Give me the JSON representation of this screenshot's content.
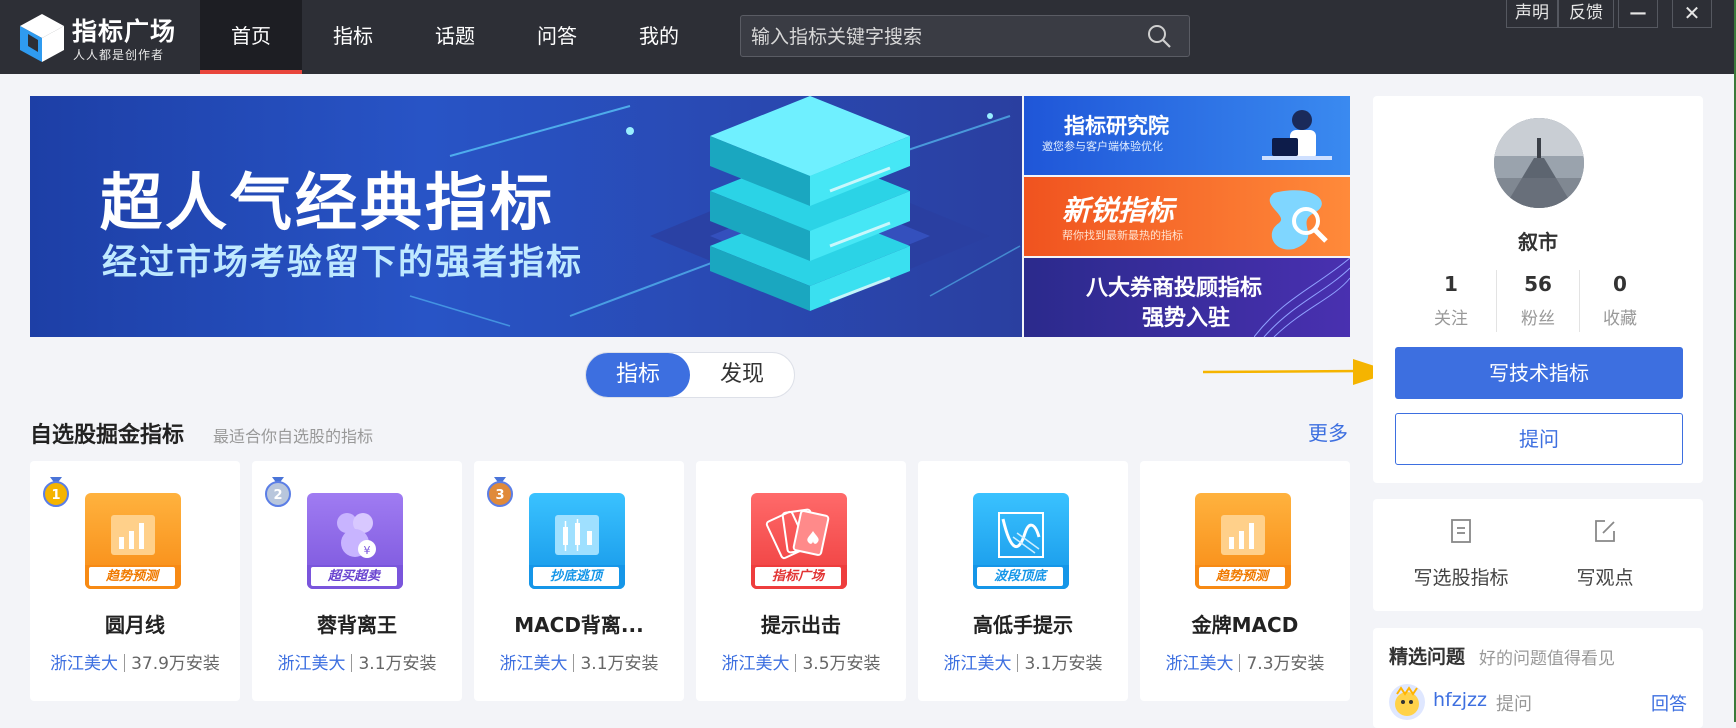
{
  "header": {
    "logo_title": "指标广场",
    "logo_subtitle": "人人都是创作者",
    "nav": [
      {
        "label": "首页",
        "active": true
      },
      {
        "label": "指标"
      },
      {
        "label": "话题"
      },
      {
        "label": "问答"
      },
      {
        "label": "我的"
      }
    ],
    "search_placeholder": "输入指标关键字搜索",
    "window_buttons": {
      "statement": "声明",
      "feedback": "反馈",
      "minimize": "—",
      "close": "✕"
    }
  },
  "banner": {
    "title": "超人气经典指标",
    "subtitle": "经过市场考验留下的强者指标",
    "side": [
      {
        "title": "指标研究院",
        "subtitle": "邀您参与客户端体验优化"
      },
      {
        "title": "新锐指标",
        "subtitle": "帮你找到最新最热的指标"
      },
      {
        "title_line1": "八大券商投顾指标",
        "title_line2": "强势入驻"
      }
    ]
  },
  "toggle": {
    "active": "指标",
    "inactive": "发现"
  },
  "section": {
    "title": "自选股掘金指标",
    "desc": "最适合你自选股的指标",
    "more": "更多"
  },
  "cards": [
    {
      "name": "圆月线",
      "author": "浙江美大",
      "installs": "37.9万安装",
      "tag": "趋势预测",
      "rank": "1"
    },
    {
      "name": "蓉背离王",
      "author": "浙江美大",
      "installs": "3.1万安装",
      "tag": "超买超卖",
      "rank": "2"
    },
    {
      "name": "MACD背离...",
      "author": "浙江美大",
      "installs": "3.1万安装",
      "tag": "抄底逃顶",
      "rank": "3"
    },
    {
      "name": "提示出击",
      "author": "浙江美大",
      "installs": "3.5万安装",
      "tag": "指标广场"
    },
    {
      "name": "高低手提示",
      "author": "浙江美大",
      "installs": "3.1万安装",
      "tag": "波段顶底"
    },
    {
      "name": "金牌MACD",
      "author": "浙江美大",
      "installs": "7.3万安装",
      "tag": "趋势预测"
    }
  ],
  "profile": {
    "name": "叙市",
    "stats": [
      {
        "value": "1",
        "label": "关注"
      },
      {
        "value": "56",
        "label": "粉丝"
      },
      {
        "value": "0",
        "label": "收藏"
      }
    ],
    "write_indicator": "写技术指标",
    "ask": "提问"
  },
  "actions": [
    {
      "label": "写选股指标",
      "icon": "document-icon"
    },
    {
      "label": "写观点",
      "icon": "edit-icon"
    }
  ],
  "questions": {
    "title": "精选问题",
    "desc": "好的问题值得看见",
    "item": {
      "user": "hfzjzz",
      "action": "提问",
      "answer": "回答"
    }
  }
}
